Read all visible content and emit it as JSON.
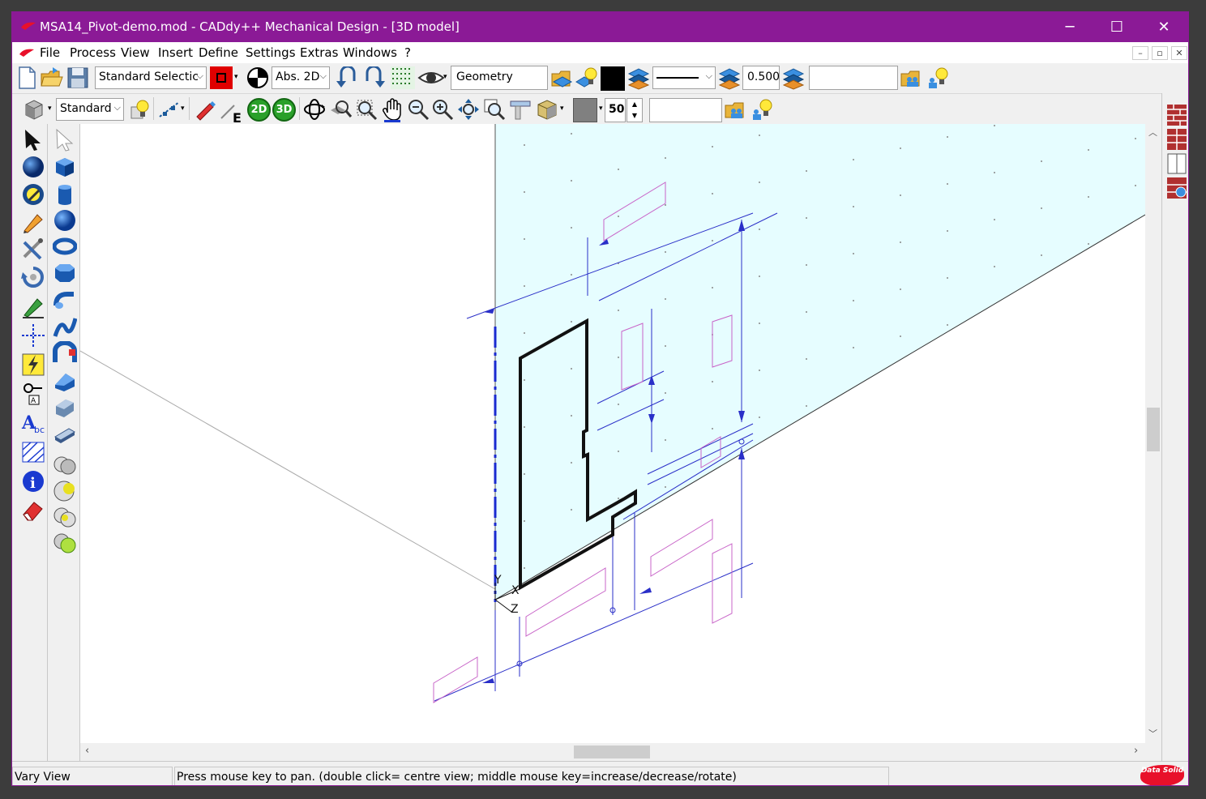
{
  "window": {
    "title": "MSA14_Pivot-demo.mod  -  CADdy++ Mechanical Design - [3D model]",
    "minimize": "─",
    "maximize": "☐",
    "close": "✕",
    "accent": "#8b1a96"
  },
  "menu": {
    "items": [
      "File",
      "Process",
      "View",
      "Insert",
      "Define",
      "Settings",
      "Extras",
      "Windows",
      "?"
    ],
    "mdi_minimize": "–",
    "mdi_restore": "▫",
    "mdi_close": "✕"
  },
  "toolbar1": {
    "selection_mode": "Standard Selectic",
    "coord_mode": "Abs. 2D",
    "layer_name": "Geometry",
    "line_width": "0.500",
    "line_style": "solid",
    "free_field": "",
    "color": "#000000",
    "pen_color": "#e00000"
  },
  "toolbar2": {
    "view_preset": "Standard",
    "btn_2d": "2D",
    "btn_3d": "3D",
    "spin_value": "50",
    "free_field": "",
    "grey_swatch": "#808080"
  },
  "status": {
    "mode": "Vary View",
    "hint": "Press mouse key to pan. (double click= centre view; middle mouse key=increase/decrease/rotate)",
    "brand": "Data Solid"
  },
  "canvas": {
    "axis_y": "Y",
    "axis_x": "X",
    "axis_z": "Z",
    "plane_color": "#e6fdff",
    "dimension_color": "#2a2fc8",
    "hidden_color": "#c864c8"
  },
  "icons": {
    "left_col1": [
      "arrow-select-icon",
      "sphere-icon",
      "wrench-sphere-icon",
      "pencil-icon",
      "tools-icon",
      "rotate-icon",
      "green-pencil-icon",
      "construction-cross-icon",
      "lightning-icon",
      "text-symbol-icon",
      "text-abc-icon",
      "hatch-icon",
      "info-icon",
      "eraser-icon"
    ],
    "left_col2": [
      "ghost-arrow-icon",
      "cube-icon",
      "cylinder-icon",
      "ball-icon",
      "torus-icon",
      "prism-icon",
      "sweep-icon",
      "spline-sweep-icon",
      "revolve-icon",
      "wedge-icon",
      "extrude-icon",
      "flat-plate-icon",
      "boolean-union-icon",
      "boolean-subtract-icon",
      "boolean-intersect-icon",
      "boolean-green-icon"
    ]
  }
}
